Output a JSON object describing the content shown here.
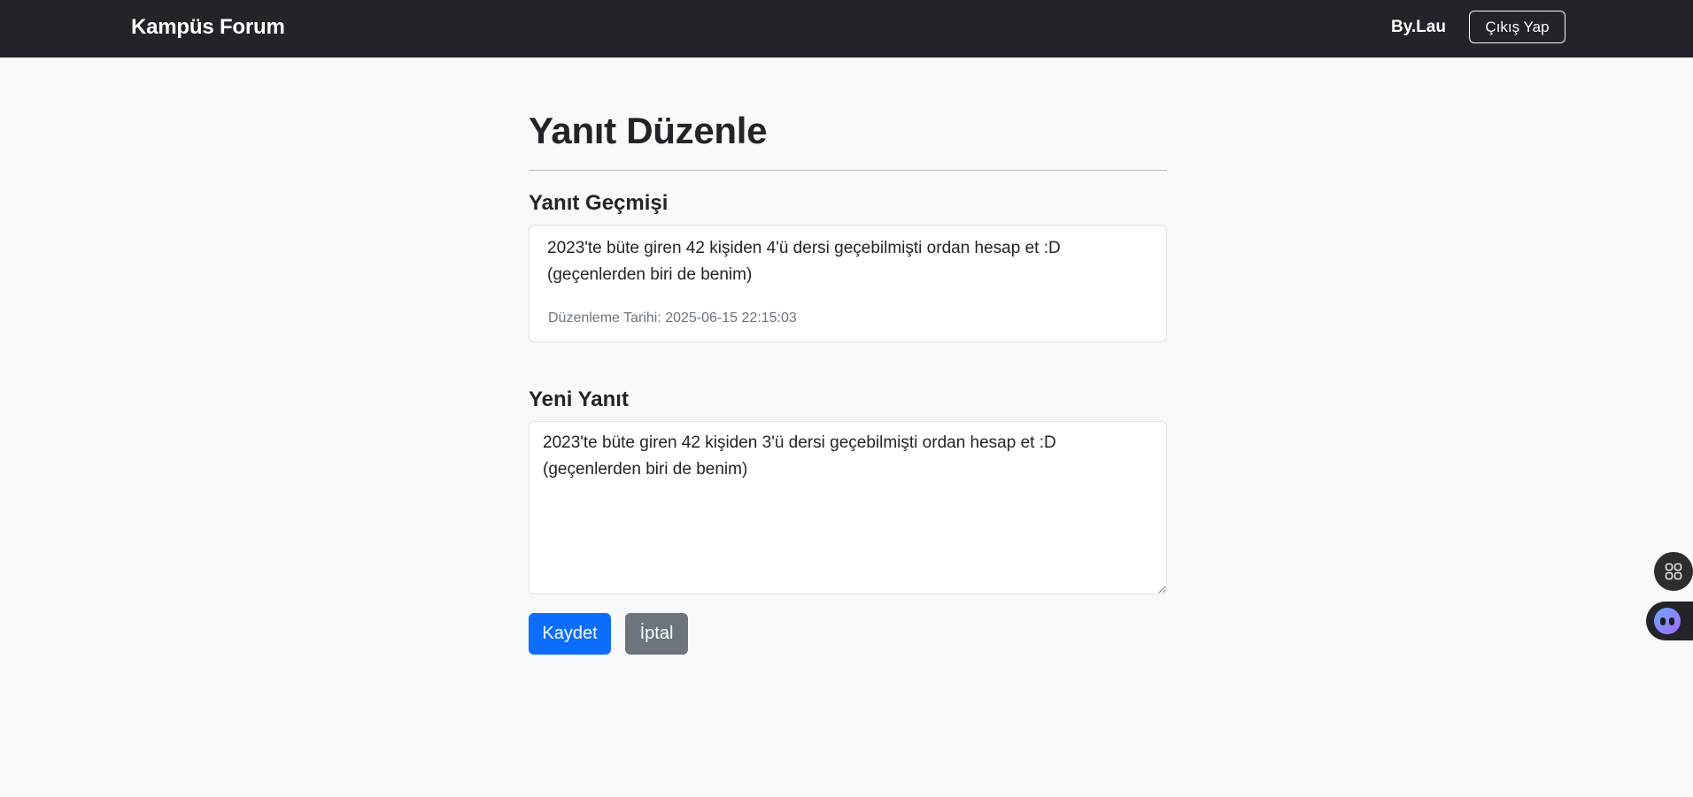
{
  "navbar": {
    "brand": "Kampüs Forum",
    "username": "By.Lau",
    "logout_label": "Çıkış Yap"
  },
  "page": {
    "title": "Yanıt Düzenle"
  },
  "history": {
    "heading": "Yanıt Geçmişi",
    "entries": [
      {
        "text": "2023'te büte giren 42 kişiden 4'ü dersi geçebilmişti ordan hesap et :D (geçenlerden biri de benim)",
        "edit_date": "Düzenleme Tarihi: 2025-06-15 22:15:03"
      }
    ]
  },
  "new_reply": {
    "heading": "Yeni Yanıt",
    "value": "2023'te büte giren 42 kişiden 3'ü dersi geçebilmişti ordan hesap et :D (geçenlerden biri de benim)"
  },
  "actions": {
    "save_label": "Kaydet",
    "cancel_label": "İptal"
  },
  "floating": {
    "apps_icon": "grid-apps-icon",
    "assistant_icon": "assistant-bot-icon"
  },
  "colors": {
    "navbar": "#212529",
    "primary": "#0d6efd",
    "secondary": "#6c757d",
    "background": "#f8f9fa"
  }
}
